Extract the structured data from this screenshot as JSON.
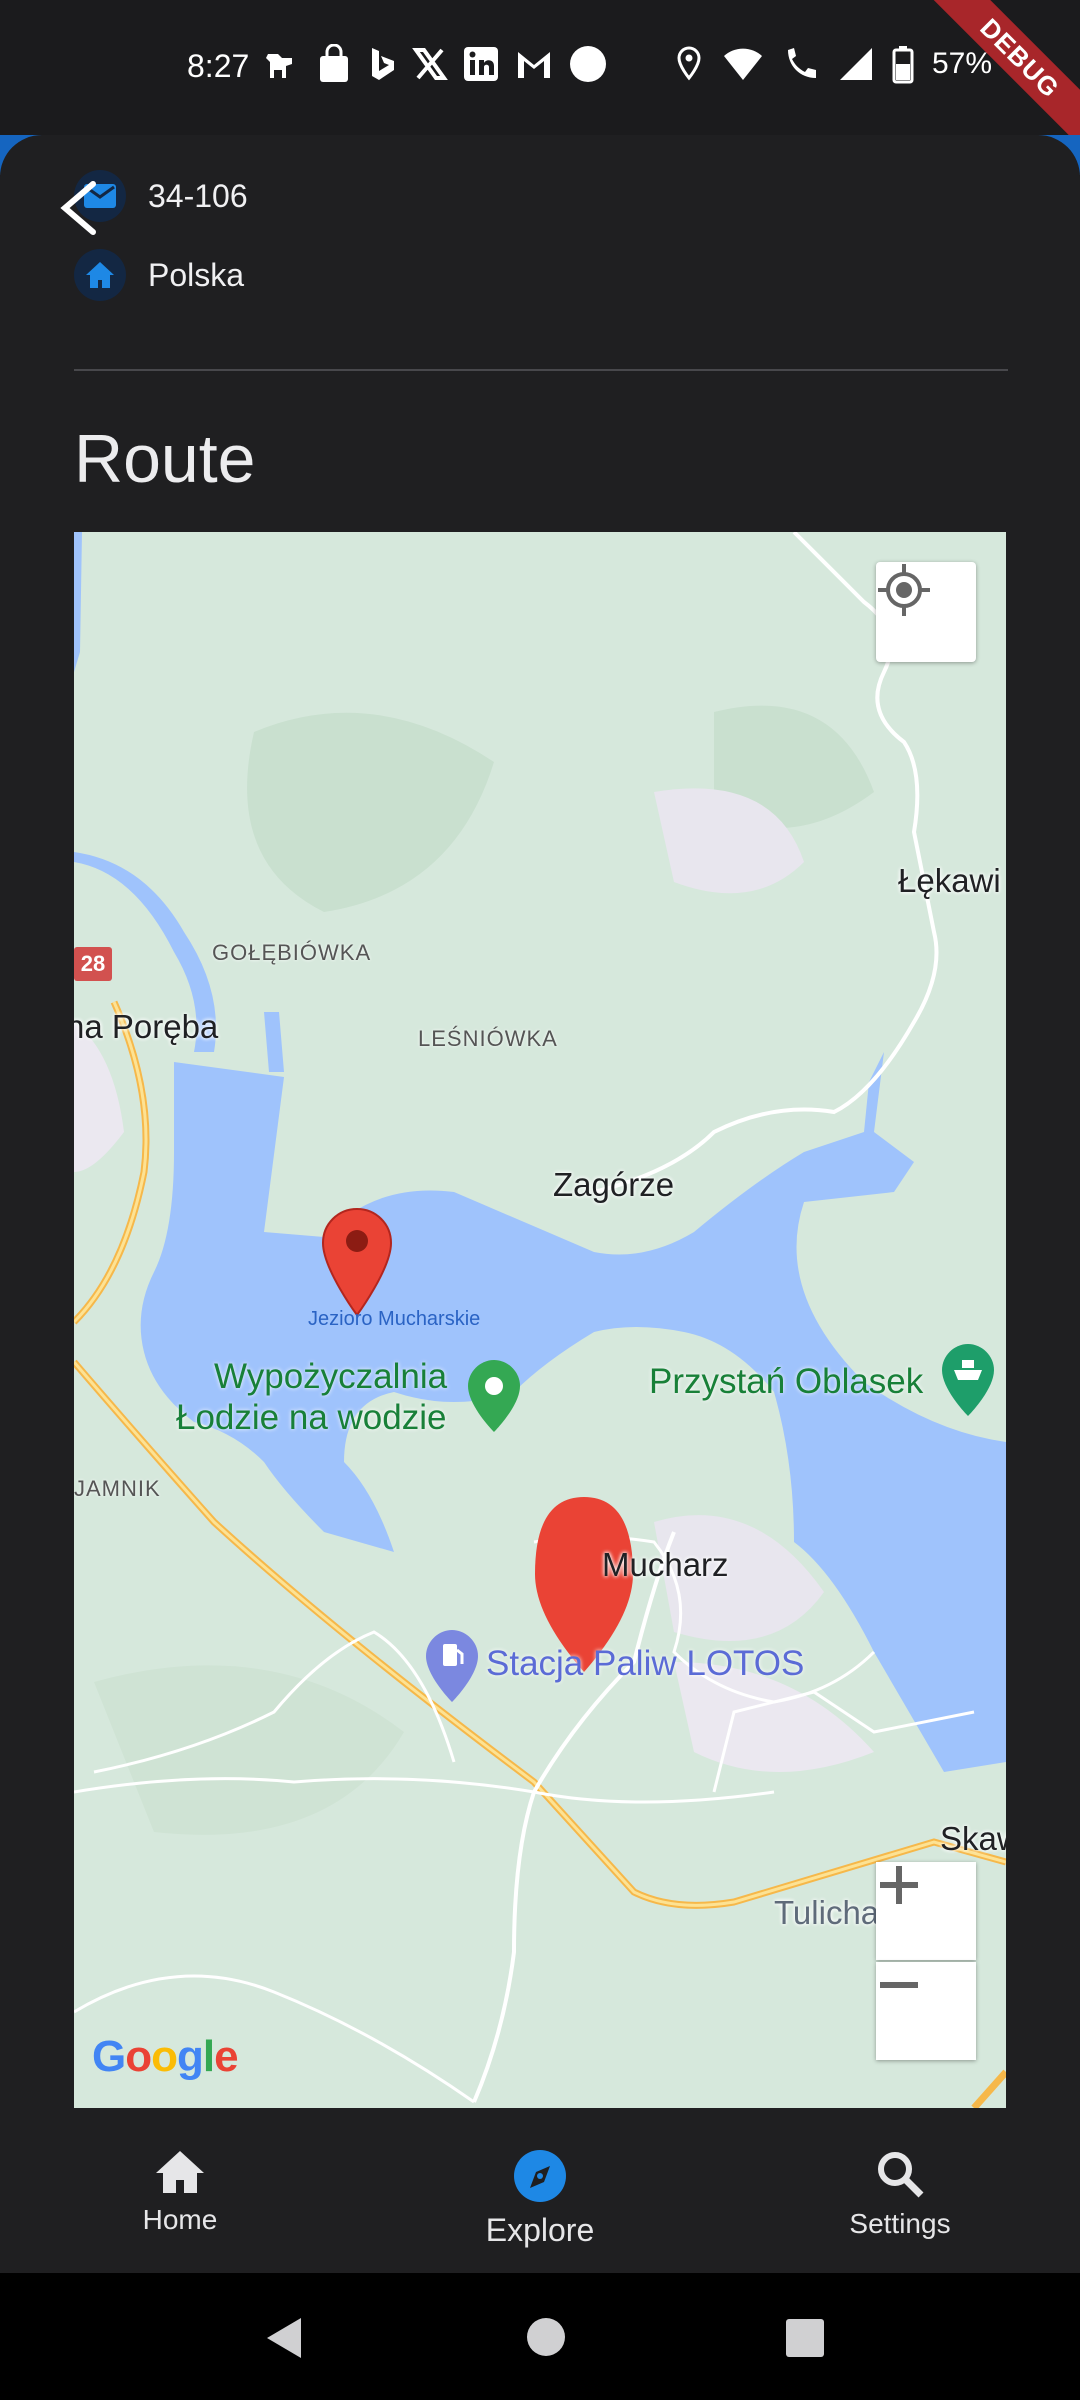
{
  "status_bar": {
    "time": "8:27",
    "battery_percent": "57%",
    "debug_banner": "DEBUG"
  },
  "contact": {
    "postal_code": "34-106",
    "country": "Polska"
  },
  "route": {
    "title": "Route"
  },
  "map": {
    "labels": {
      "lekawica": "Łękawi",
      "golebiowka": "GOŁĘBIÓWKA",
      "poreba": "na Poręba",
      "lesniowka": "LEŚNIÓWKA",
      "zagorze": "Zagórze",
      "lake": "Jezioro Mucharskie",
      "wypozyczalnia_1": "Wypożyczalnia",
      "wypozyczalnia_2": "Łodzie na wodzie",
      "przystan": "Przystań Oblasek",
      "jamnik": "JAMNIK",
      "mucharz": "Mucharz",
      "stacja": "Stacja Paliw LOTOS",
      "skawce": "Skaw",
      "tulichatki": "Tulichatk",
      "road_number": "28"
    },
    "provider_logo": "Google"
  },
  "bottom_nav": {
    "items": [
      {
        "label": "Home",
        "icon": "home-icon",
        "active": false
      },
      {
        "label": "Explore",
        "icon": "explore-icon",
        "active": true
      },
      {
        "label": "Settings",
        "icon": "search-icon",
        "active": false
      }
    ]
  },
  "colors": {
    "accent": "#1e88e5",
    "water": "#9fc3fc",
    "land": "#d6e8dc",
    "marker": "#ea4335",
    "road_major": "#f6b84a"
  }
}
